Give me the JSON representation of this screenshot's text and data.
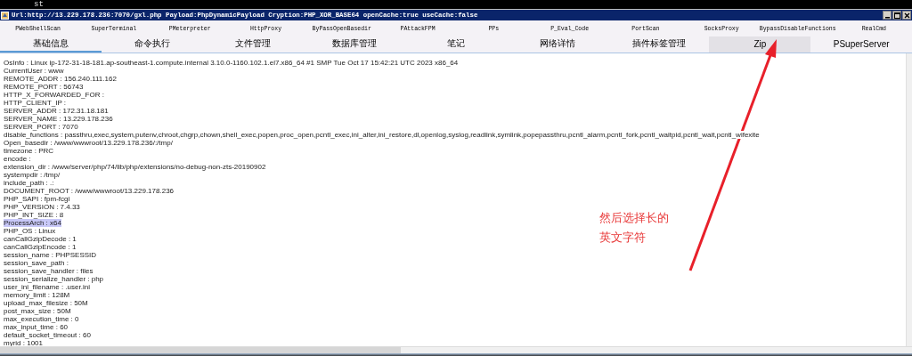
{
  "top_bar": {
    "label": "st"
  },
  "window": {
    "title": "Url:http://13.229.178.236:7070/gxl.php Payload:PhpDynamicPayload Cryption:PHP_XOR_BASE64 openCache:true useCache:false"
  },
  "plugin_tabs": [
    {
      "label": "PWebShellScan"
    },
    {
      "label": "SuperTerminal"
    },
    {
      "label": "PMeterpreter"
    },
    {
      "label": "HttpProxy"
    },
    {
      "label": "ByPassOpenBasedir"
    },
    {
      "label": "PAttackFPM"
    },
    {
      "label": "PPs"
    },
    {
      "label": "P_Eval_Code"
    },
    {
      "label": "PortScan"
    },
    {
      "label": "SocksProxy"
    },
    {
      "label": "BypassDisableFunctions"
    },
    {
      "label": "RealCmd"
    }
  ],
  "tabs": [
    {
      "label": "基础信息",
      "selected": true,
      "hovered": false
    },
    {
      "label": "命令执行",
      "selected": false,
      "hovered": false
    },
    {
      "label": "文件管理",
      "selected": false,
      "hovered": false
    },
    {
      "label": "数据库管理",
      "selected": false,
      "hovered": false
    },
    {
      "label": "笔记",
      "selected": false,
      "hovered": false
    },
    {
      "label": "网络详情",
      "selected": false,
      "hovered": false
    },
    {
      "label": "插件标签管理",
      "selected": false,
      "hovered": false
    },
    {
      "label": "Zip",
      "selected": false,
      "hovered": true
    },
    {
      "label": "PSuperServer",
      "selected": false,
      "hovered": false
    }
  ],
  "info_lines": [
    {
      "text": "OsInfo : Linux ip-172-31-18-181.ap-southeast-1.compute.internal 3.10.0-1160.102.1.el7.x86_64 #1 SMP Tue Oct 17 15:42:21 UTC 2023 x86_64",
      "selected": false
    },
    {
      "text": "CurrentUser : www",
      "selected": false
    },
    {
      "text": "REMOTE_ADDR : 156.240.111.162",
      "selected": false
    },
    {
      "text": "REMOTE_PORT : 56743",
      "selected": false
    },
    {
      "text": "HTTP_X_FORWARDED_FOR :",
      "selected": false
    },
    {
      "text": "HTTP_CLIENT_IP :",
      "selected": false
    },
    {
      "text": "SERVER_ADDR : 172.31.18.181",
      "selected": false
    },
    {
      "text": "SERVER_NAME : 13.229.178.236",
      "selected": false
    },
    {
      "text": "SERVER_PORT : 7070",
      "selected": false
    },
    {
      "text": "disable_functions : passthru,exec,system,putenv,chroot,chgrp,chown,shell_exec,popen,proc_open,pcntl_exec,ini_alter,ini_restore,dl,openlog,syslog,readlink,symlink,popepassthru,pcntl_alarm,pcntl_fork,pcntl_waitpid,pcntl_wait,pcntl_wifexite",
      "selected": false
    },
    {
      "text": "Open_basedir : /www/wwwroot/13.229.178.236/:/tmp/",
      "selected": false
    },
    {
      "text": "timezone : PRC",
      "selected": false
    },
    {
      "text": "encode :",
      "selected": false
    },
    {
      "text": "extension_dir : /www/server/php/74/lib/php/extensions/no-debug-non-zts-20190902",
      "selected": false
    },
    {
      "text": "systempdir : /tmp/",
      "selected": false
    },
    {
      "text": "include_path : .:",
      "selected": false
    },
    {
      "text": "DOCUMENT_ROOT : /www/wwwroot/13.229.178.236",
      "selected": false
    },
    {
      "text": "PHP_SAPI : fpm-fcgi",
      "selected": false
    },
    {
      "text": "PHP_VERSION : 7.4.33",
      "selected": false
    },
    {
      "text": "PHP_INT_SIZE : 8",
      "selected": false
    },
    {
      "text": "ProcessArch : x64",
      "selected": true
    },
    {
      "text": "PHP_OS : Linux",
      "selected": false
    },
    {
      "text": "canCallGzipDecode : 1",
      "selected": false
    },
    {
      "text": "canCallGzipEncode : 1",
      "selected": false
    },
    {
      "text": "session_name : PHPSESSID",
      "selected": false
    },
    {
      "text": "session_save_path :",
      "selected": false
    },
    {
      "text": "session_save_handler : files",
      "selected": false
    },
    {
      "text": "session_serialize_handler : php",
      "selected": false
    },
    {
      "text": "user_ini_filename : .user.ini",
      "selected": false
    },
    {
      "text": "memory_limit : 128M",
      "selected": false
    },
    {
      "text": "upload_max_filesize : 50M",
      "selected": false
    },
    {
      "text": "post_max_size : 50M",
      "selected": false
    },
    {
      "text": "max_execution_time : 0",
      "selected": false
    },
    {
      "text": "max_input_time : 60",
      "selected": false
    },
    {
      "text": "default_socket_timeout : 60",
      "selected": false
    },
    {
      "text": "myrid : 1001",
      "selected": false
    }
  ],
  "annotation": {
    "lines": [
      "然后选择长的",
      "英文字符"
    ]
  }
}
